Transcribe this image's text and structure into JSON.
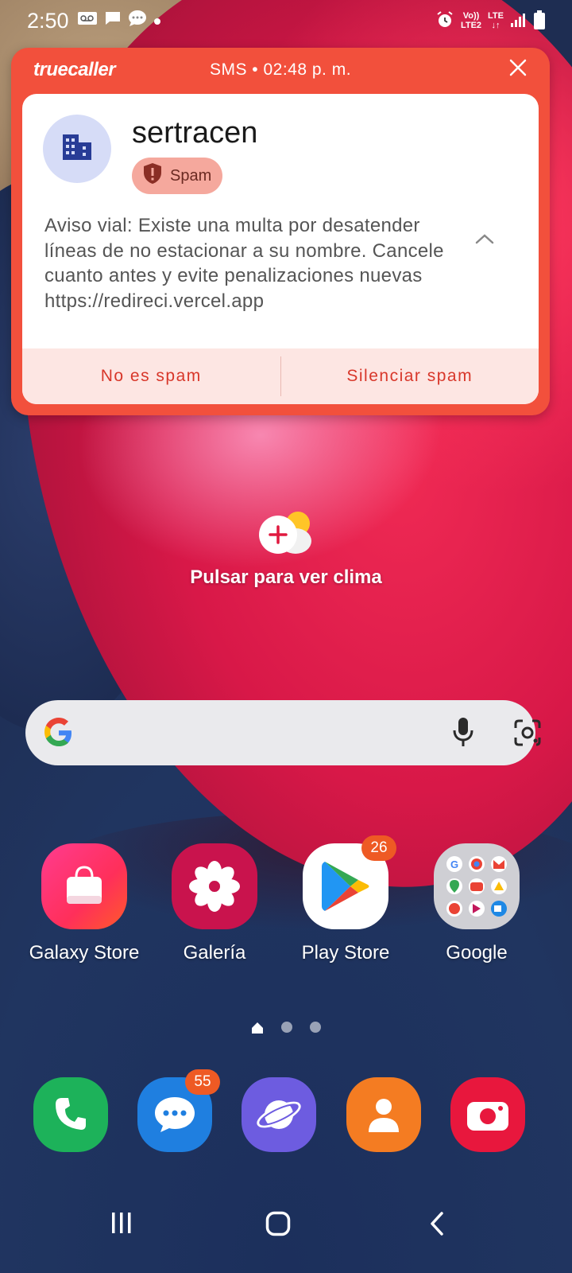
{
  "status_bar": {
    "time": "2:50",
    "left_icons": [
      "voicemail-icon",
      "message-icon",
      "chat-icon",
      "dot-icon"
    ],
    "right_icons": [
      "alarm-icon",
      "volte-icon",
      "lte-icon",
      "signal-icon",
      "battery-icon"
    ],
    "volte_label": "Vo))",
    "lte2_label": "LTE2",
    "lte_label": "LTE"
  },
  "notification": {
    "app_name": "truecaller",
    "meta": "SMS • 02:48 p. m.",
    "sender": "sertracen",
    "badge": "Spam",
    "message": "Aviso vial: Existe una multa por desatender líneas de no estacionar a su nombre. Cancele cuanto antes y evite penalizaciones nuevas https://redireci.vercel.app",
    "actions": {
      "not_spam": "No es spam",
      "mute_spam": "Silenciar spam"
    },
    "colors": {
      "header": "#f2503c",
      "action_text": "#d8372a",
      "badge_bg": "#f5a89d"
    }
  },
  "weather": {
    "label": "Pulsar para ver clima"
  },
  "search": {
    "icons": [
      "google-logo",
      "mic-icon",
      "lens-icon"
    ]
  },
  "apps": [
    {
      "label": "Galaxy Store",
      "icon": "galaxy-store-icon"
    },
    {
      "label": "Galería",
      "icon": "gallery-icon"
    },
    {
      "label": "Play Store",
      "icon": "play-store-icon",
      "badge": "26"
    },
    {
      "label": "Google",
      "icon": "google-folder-icon"
    }
  ],
  "dock": [
    {
      "icon": "phone-icon"
    },
    {
      "icon": "messages-icon",
      "badge": "55"
    },
    {
      "icon": "internet-icon"
    },
    {
      "icon": "contacts-icon"
    },
    {
      "icon": "camera-icon"
    }
  ],
  "page_indicator": {
    "pages": 3,
    "current": "home"
  },
  "nav": [
    "recents-button",
    "home-button",
    "back-button"
  ]
}
